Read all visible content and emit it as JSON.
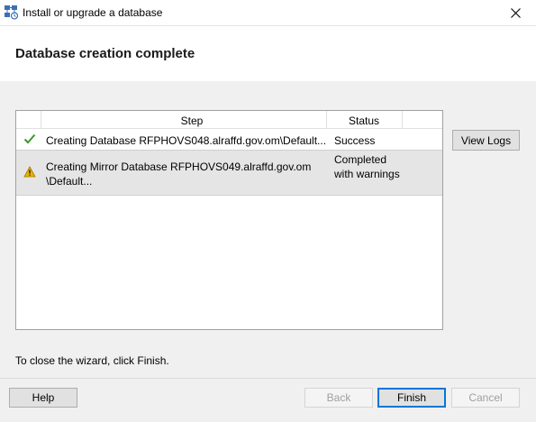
{
  "window": {
    "title": "Install or upgrade a database",
    "close_icon": "close-icon",
    "app_icon": "database-app-icon"
  },
  "header": {
    "title": "Database creation complete"
  },
  "grid": {
    "columns": [
      "Step",
      "Status"
    ],
    "rows": [
      {
        "icon": "check-icon",
        "step": "Creating Database RFPHOVS048.alraffd.gov.om\\Default...",
        "status": "Success"
      },
      {
        "icon": "warning-icon",
        "step": "Creating Mirror Database RFPHOVS049.alraffd.gov.om\n\\Default...",
        "status": "Completed with warnings"
      }
    ]
  },
  "side": {
    "view_logs_label": "View Logs"
  },
  "hint": "To close the wizard, click Finish.",
  "footer": {
    "help_label": "Help",
    "back_label": "Back",
    "finish_label": "Finish",
    "cancel_label": "Cancel"
  },
  "colors": {
    "success": "#3a9a2a",
    "warning": "#e8b400",
    "accent": "#0078d7"
  }
}
